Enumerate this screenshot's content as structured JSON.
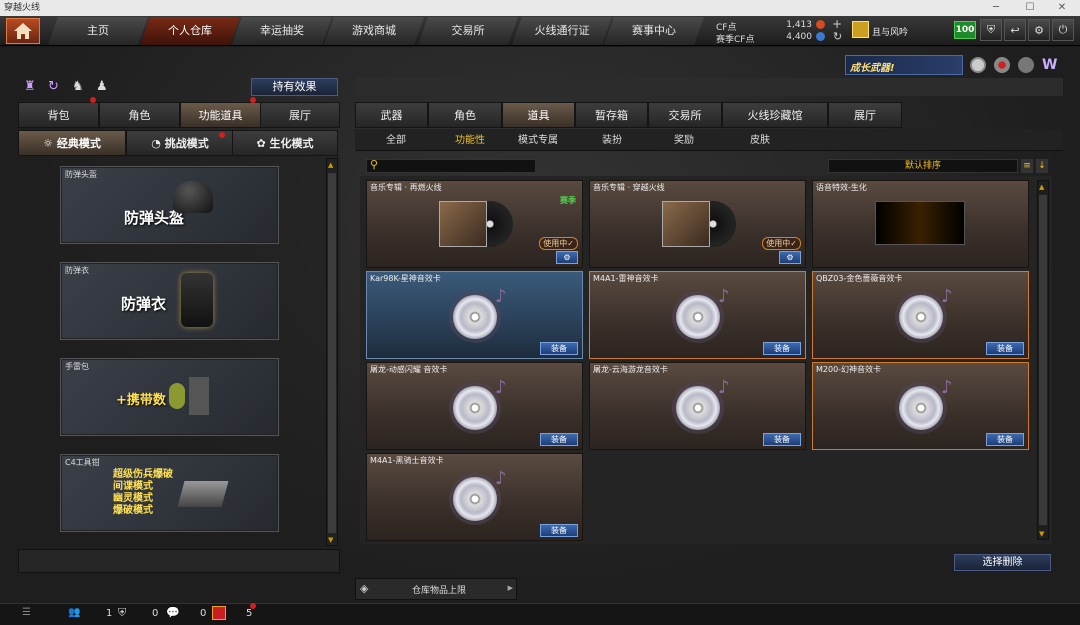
{
  "window": {
    "title": "穿越火线",
    "min": "─",
    "max": "☐",
    "close": "✕"
  },
  "nav": {
    "home_icon": "home-icon",
    "tabs": [
      {
        "label": "主页",
        "active": false
      },
      {
        "label": "个人仓库",
        "active": true
      },
      {
        "label": "幸运抽奖",
        "active": false
      },
      {
        "label": "游戏商城",
        "active": false
      },
      {
        "label": "交易所",
        "active": false
      },
      {
        "label": "火线通行证",
        "active": false
      },
      {
        "label": "赛事中心",
        "active": false
      }
    ],
    "cf_label": "CF点",
    "cf_value": "1,413",
    "voucher_label": "赛季CF点",
    "voucher_value": "4,400",
    "plus": "+",
    "refresh": "↻",
    "username": "且与风吟",
    "level": "100"
  },
  "banner": {
    "text": "成长武器!"
  },
  "left": {
    "effect_button": "持有效果",
    "tabs": [
      {
        "label": "背包",
        "active": false
      },
      {
        "label": "角色",
        "active": false
      },
      {
        "label": "功能道具",
        "active": true
      },
      {
        "label": "展厅",
        "active": false
      }
    ],
    "modes": [
      {
        "label": "经典模式",
        "active": true
      },
      {
        "label": "挑战模式",
        "active": false
      },
      {
        "label": "生化模式",
        "active": false
      }
    ],
    "cards": [
      {
        "caption": "防弹头盔",
        "big": "防弹头盔"
      },
      {
        "caption": "防弹衣",
        "big": "防弹衣"
      },
      {
        "caption": "手雷包",
        "big": "+携带数"
      },
      {
        "caption": "C4工具钳",
        "lines": [
          "超级伤兵爆破",
          "间谍模式",
          "幽灵模式",
          "爆破模式"
        ]
      }
    ]
  },
  "right": {
    "tabs": [
      {
        "label": "武器",
        "active": false
      },
      {
        "label": "角色",
        "active": false
      },
      {
        "label": "道具",
        "active": true
      },
      {
        "label": "暂存箱",
        "active": false
      },
      {
        "label": "交易所",
        "active": false
      },
      {
        "label": "火线珍藏馆",
        "active": false
      },
      {
        "label": "展厅",
        "active": false
      }
    ],
    "subtabs": [
      {
        "label": "全部",
        "active": false
      },
      {
        "label": "功能性",
        "active": true
      },
      {
        "label": "模式专属",
        "active": false
      },
      {
        "label": "装扮",
        "active": false
      },
      {
        "label": "奖励",
        "active": false
      },
      {
        "label": "皮肤",
        "active": false
      }
    ],
    "search_placeholder": "",
    "sort_label": "默认排序",
    "items": [
      {
        "title": "音乐专辑 · 再燃火线",
        "type": "album",
        "badge": "赛季",
        "inuse": "使用中✓"
      },
      {
        "title": "音乐专辑 · 穿越火线",
        "type": "album",
        "inuse": "使用中✓"
      },
      {
        "title": "语音特效-生化",
        "type": "effect"
      },
      {
        "title": "Kar98K-星神音效卡",
        "type": "disc",
        "style": "blue",
        "equip": "装备"
      },
      {
        "title": "M4A1-雷神音效卡",
        "type": "disc",
        "style": "sel",
        "equip": "装备"
      },
      {
        "title": "QBZ03-金色蔷薇音效卡",
        "type": "disc",
        "style": "sel",
        "equip": "装备"
      },
      {
        "title": "屠龙-动感闪耀 音效卡",
        "type": "disc",
        "equip": "装备"
      },
      {
        "title": "屠龙-云海游龙音效卡",
        "type": "disc",
        "equip": "装备"
      },
      {
        "title": "M200-幻神音效卡",
        "type": "disc",
        "style": "sel",
        "equip": "装备"
      },
      {
        "title": "M4A1-黑骑士音效卡",
        "type": "disc",
        "equip": "装备"
      }
    ],
    "delete_button": "选择删除",
    "storage_label": "仓库物品上限"
  },
  "status": {
    "v1": "1",
    "v2": "0",
    "v3": "0",
    "v4": "5"
  }
}
